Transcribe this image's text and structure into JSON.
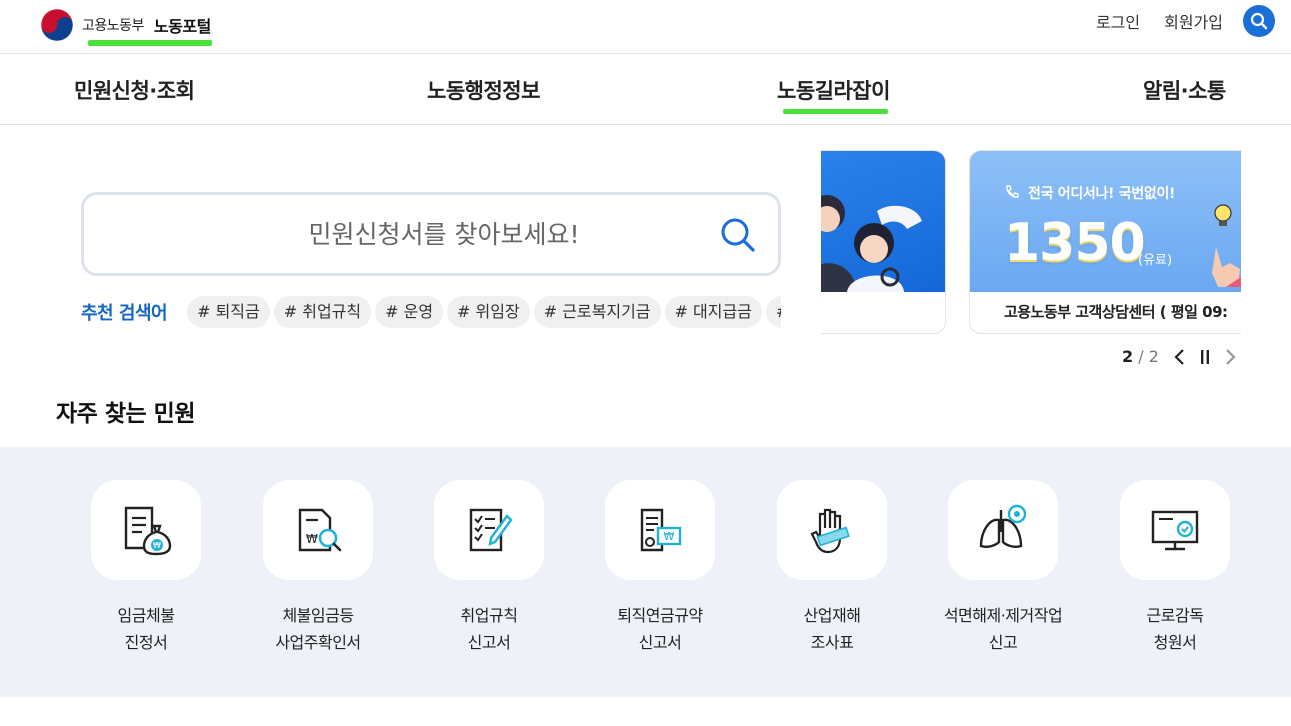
{
  "header": {
    "ministry": "고용노동부",
    "portal": "노동포털",
    "login": "로그인",
    "signup": "회원가입"
  },
  "gnb": [
    "민원신청·조회",
    "노동행정정보",
    "노동길라잡이",
    "알림·소통"
  ],
  "search": {
    "placeholder": "민원신청서를 찾아보세요!",
    "rec_label": "추천 검색어",
    "tags": [
      "# 퇴직금",
      "# 취업규칙",
      "# 운영",
      "# 위임장",
      "# 근로복지기금",
      "# 대지급금",
      "#"
    ]
  },
  "banner": {
    "small_text": "전국 어디서나! 국번없이!",
    "number": "1350",
    "paid": "(유료)",
    "caption": "고용노동부 고객상담센터 ( 평일 09:"
  },
  "pager": {
    "current": "2",
    "separator": "/",
    "total": "2"
  },
  "frequent": {
    "title": "자주 찾는 민원",
    "items": [
      {
        "line1": "임금체불",
        "line2": "진정서",
        "icon": "wage-document-icon"
      },
      {
        "line1": "체불임금등",
        "line2": "사업주확인서",
        "icon": "document-search-icon"
      },
      {
        "line1": "취업규칙",
        "line2": "신고서",
        "icon": "checklist-pen-icon"
      },
      {
        "line1": "퇴직연금규약",
        "line2": "신고서",
        "icon": "certificate-icon"
      },
      {
        "line1": "산업재해",
        "line2": "조사표",
        "icon": "injured-hand-icon"
      },
      {
        "line1": "석면해제·제거작업",
        "line2": "신고",
        "icon": "lungs-icon"
      },
      {
        "line1": "근로감독",
        "line2": "청원서",
        "icon": "monitor-check-icon"
      }
    ]
  },
  "colors": {
    "accent": "#1a6ed8",
    "highlight": "#4be03a",
    "section_bg": "#eef2f8"
  }
}
